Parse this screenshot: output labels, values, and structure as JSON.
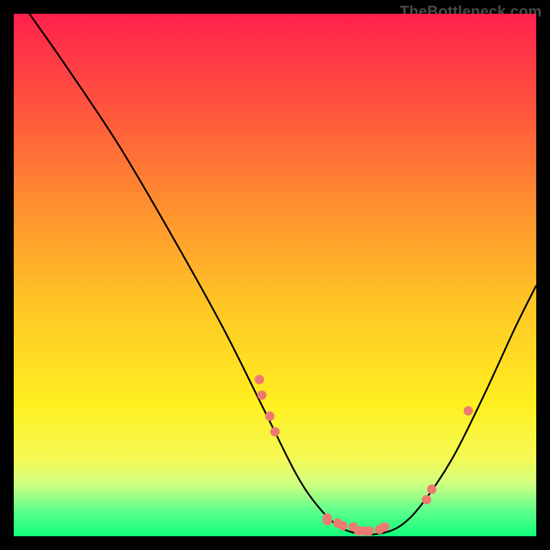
{
  "watermark": "TheBottleneck.com",
  "chart_data": {
    "type": "line",
    "title": "",
    "xlabel": "",
    "ylabel": "",
    "xlim": [
      0,
      100
    ],
    "ylim": [
      0,
      100
    ],
    "curve": [
      {
        "x": 3,
        "y": 100
      },
      {
        "x": 10,
        "y": 90
      },
      {
        "x": 20,
        "y": 75
      },
      {
        "x": 30,
        "y": 58
      },
      {
        "x": 40,
        "y": 40
      },
      {
        "x": 48,
        "y": 24
      },
      {
        "x": 54,
        "y": 12
      },
      {
        "x": 58,
        "y": 6
      },
      {
        "x": 62,
        "y": 2
      },
      {
        "x": 66,
        "y": 0.5
      },
      {
        "x": 70,
        "y": 0.5
      },
      {
        "x": 74,
        "y": 2
      },
      {
        "x": 78,
        "y": 6
      },
      {
        "x": 84,
        "y": 15
      },
      {
        "x": 90,
        "y": 27
      },
      {
        "x": 96,
        "y": 40
      },
      {
        "x": 100,
        "y": 48
      }
    ],
    "points": [
      {
        "x": 47,
        "y": 30
      },
      {
        "x": 47.5,
        "y": 27
      },
      {
        "x": 49,
        "y": 23
      },
      {
        "x": 50,
        "y": 20
      },
      {
        "x": 60,
        "y": 3.5
      },
      {
        "x": 60,
        "y": 3
      },
      {
        "x": 62,
        "y": 2.5
      },
      {
        "x": 63,
        "y": 2
      },
      {
        "x": 65,
        "y": 1.8
      },
      {
        "x": 66,
        "y": 1
      },
      {
        "x": 67,
        "y": 1
      },
      {
        "x": 68,
        "y": 1
      },
      {
        "x": 70,
        "y": 1.3
      },
      {
        "x": 71,
        "y": 1.8
      },
      {
        "x": 79,
        "y": 7
      },
      {
        "x": 80,
        "y": 9
      },
      {
        "x": 87,
        "y": 24
      }
    ],
    "colors": {
      "curve": "#000000",
      "points": "#ed7a71",
      "gradient_top": "#ff1f4d",
      "gradient_bottom": "#10ff7a"
    }
  }
}
